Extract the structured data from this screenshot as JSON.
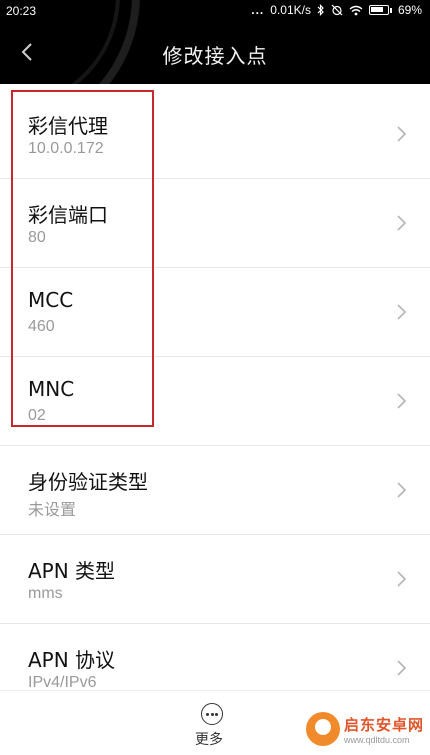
{
  "status_bar": {
    "time": "20:23",
    "dots": "...",
    "network_speed": "0.01K/s",
    "battery": "69%"
  },
  "header": {
    "title": "修改接入点"
  },
  "settings": [
    {
      "label": "彩信代理",
      "value": "10.0.0.172"
    },
    {
      "label": "彩信端口",
      "value": "80"
    },
    {
      "label": "MCC",
      "value": "460"
    },
    {
      "label": "MNC",
      "value": "02"
    },
    {
      "label": "身份验证类型",
      "value": "未设置"
    },
    {
      "label": "APN 类型",
      "value": "mms"
    },
    {
      "label": "APN 协议",
      "value": "IPv4/IPv6"
    }
  ],
  "bottom_bar": {
    "more_label": "更多"
  },
  "watermark": {
    "title": "启东安卓网",
    "url": "www.qdltdu.com"
  },
  "colors": {
    "highlight": "#c8282c",
    "header_bg": "#000000"
  }
}
